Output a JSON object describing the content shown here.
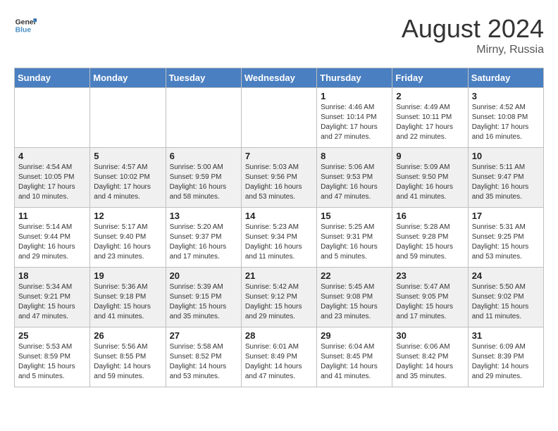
{
  "header": {
    "logo_line1": "General",
    "logo_line2": "Blue",
    "month_year": "August 2024",
    "location": "Mirny, Russia"
  },
  "weekdays": [
    "Sunday",
    "Monday",
    "Tuesday",
    "Wednesday",
    "Thursday",
    "Friday",
    "Saturday"
  ],
  "weeks": [
    [
      {
        "day": "",
        "sunrise": "",
        "sunset": "",
        "daylight": ""
      },
      {
        "day": "",
        "sunrise": "",
        "sunset": "",
        "daylight": ""
      },
      {
        "day": "",
        "sunrise": "",
        "sunset": "",
        "daylight": ""
      },
      {
        "day": "",
        "sunrise": "",
        "sunset": "",
        "daylight": ""
      },
      {
        "day": "1",
        "sunrise": "Sunrise: 4:46 AM",
        "sunset": "Sunset: 10:14 PM",
        "daylight": "Daylight: 17 hours and 27 minutes."
      },
      {
        "day": "2",
        "sunrise": "Sunrise: 4:49 AM",
        "sunset": "Sunset: 10:11 PM",
        "daylight": "Daylight: 17 hours and 22 minutes."
      },
      {
        "day": "3",
        "sunrise": "Sunrise: 4:52 AM",
        "sunset": "Sunset: 10:08 PM",
        "daylight": "Daylight: 17 hours and 16 minutes."
      }
    ],
    [
      {
        "day": "4",
        "sunrise": "Sunrise: 4:54 AM",
        "sunset": "Sunset: 10:05 PM",
        "daylight": "Daylight: 17 hours and 10 minutes."
      },
      {
        "day": "5",
        "sunrise": "Sunrise: 4:57 AM",
        "sunset": "Sunset: 10:02 PM",
        "daylight": "Daylight: 17 hours and 4 minutes."
      },
      {
        "day": "6",
        "sunrise": "Sunrise: 5:00 AM",
        "sunset": "Sunset: 9:59 PM",
        "daylight": "Daylight: 16 hours and 58 minutes."
      },
      {
        "day": "7",
        "sunrise": "Sunrise: 5:03 AM",
        "sunset": "Sunset: 9:56 PM",
        "daylight": "Daylight: 16 hours and 53 minutes."
      },
      {
        "day": "8",
        "sunrise": "Sunrise: 5:06 AM",
        "sunset": "Sunset: 9:53 PM",
        "daylight": "Daylight: 16 hours and 47 minutes."
      },
      {
        "day": "9",
        "sunrise": "Sunrise: 5:09 AM",
        "sunset": "Sunset: 9:50 PM",
        "daylight": "Daylight: 16 hours and 41 minutes."
      },
      {
        "day": "10",
        "sunrise": "Sunrise: 5:11 AM",
        "sunset": "Sunset: 9:47 PM",
        "daylight": "Daylight: 16 hours and 35 minutes."
      }
    ],
    [
      {
        "day": "11",
        "sunrise": "Sunrise: 5:14 AM",
        "sunset": "Sunset: 9:44 PM",
        "daylight": "Daylight: 16 hours and 29 minutes."
      },
      {
        "day": "12",
        "sunrise": "Sunrise: 5:17 AM",
        "sunset": "Sunset: 9:40 PM",
        "daylight": "Daylight: 16 hours and 23 minutes."
      },
      {
        "day": "13",
        "sunrise": "Sunrise: 5:20 AM",
        "sunset": "Sunset: 9:37 PM",
        "daylight": "Daylight: 16 hours and 17 minutes."
      },
      {
        "day": "14",
        "sunrise": "Sunrise: 5:23 AM",
        "sunset": "Sunset: 9:34 PM",
        "daylight": "Daylight: 16 hours and 11 minutes."
      },
      {
        "day": "15",
        "sunrise": "Sunrise: 5:25 AM",
        "sunset": "Sunset: 9:31 PM",
        "daylight": "Daylight: 16 hours and 5 minutes."
      },
      {
        "day": "16",
        "sunrise": "Sunrise: 5:28 AM",
        "sunset": "Sunset: 9:28 PM",
        "daylight": "Daylight: 15 hours and 59 minutes."
      },
      {
        "day": "17",
        "sunrise": "Sunrise: 5:31 AM",
        "sunset": "Sunset: 9:25 PM",
        "daylight": "Daylight: 15 hours and 53 minutes."
      }
    ],
    [
      {
        "day": "18",
        "sunrise": "Sunrise: 5:34 AM",
        "sunset": "Sunset: 9:21 PM",
        "daylight": "Daylight: 15 hours and 47 minutes."
      },
      {
        "day": "19",
        "sunrise": "Sunrise: 5:36 AM",
        "sunset": "Sunset: 9:18 PM",
        "daylight": "Daylight: 15 hours and 41 minutes."
      },
      {
        "day": "20",
        "sunrise": "Sunrise: 5:39 AM",
        "sunset": "Sunset: 9:15 PM",
        "daylight": "Daylight: 15 hours and 35 minutes."
      },
      {
        "day": "21",
        "sunrise": "Sunrise: 5:42 AM",
        "sunset": "Sunset: 9:12 PM",
        "daylight": "Daylight: 15 hours and 29 minutes."
      },
      {
        "day": "22",
        "sunrise": "Sunrise: 5:45 AM",
        "sunset": "Sunset: 9:08 PM",
        "daylight": "Daylight: 15 hours and 23 minutes."
      },
      {
        "day": "23",
        "sunrise": "Sunrise: 5:47 AM",
        "sunset": "Sunset: 9:05 PM",
        "daylight": "Daylight: 15 hours and 17 minutes."
      },
      {
        "day": "24",
        "sunrise": "Sunrise: 5:50 AM",
        "sunset": "Sunset: 9:02 PM",
        "daylight": "Daylight: 15 hours and 11 minutes."
      }
    ],
    [
      {
        "day": "25",
        "sunrise": "Sunrise: 5:53 AM",
        "sunset": "Sunset: 8:59 PM",
        "daylight": "Daylight: 15 hours and 5 minutes."
      },
      {
        "day": "26",
        "sunrise": "Sunrise: 5:56 AM",
        "sunset": "Sunset: 8:55 PM",
        "daylight": "Daylight: 14 hours and 59 minutes."
      },
      {
        "day": "27",
        "sunrise": "Sunrise: 5:58 AM",
        "sunset": "Sunset: 8:52 PM",
        "daylight": "Daylight: 14 hours and 53 minutes."
      },
      {
        "day": "28",
        "sunrise": "Sunrise: 6:01 AM",
        "sunset": "Sunset: 8:49 PM",
        "daylight": "Daylight: 14 hours and 47 minutes."
      },
      {
        "day": "29",
        "sunrise": "Sunrise: 6:04 AM",
        "sunset": "Sunset: 8:45 PM",
        "daylight": "Daylight: 14 hours and 41 minutes."
      },
      {
        "day": "30",
        "sunrise": "Sunrise: 6:06 AM",
        "sunset": "Sunset: 8:42 PM",
        "daylight": "Daylight: 14 hours and 35 minutes."
      },
      {
        "day": "31",
        "sunrise": "Sunrise: 6:09 AM",
        "sunset": "Sunset: 8:39 PM",
        "daylight": "Daylight: 14 hours and 29 minutes."
      }
    ]
  ]
}
